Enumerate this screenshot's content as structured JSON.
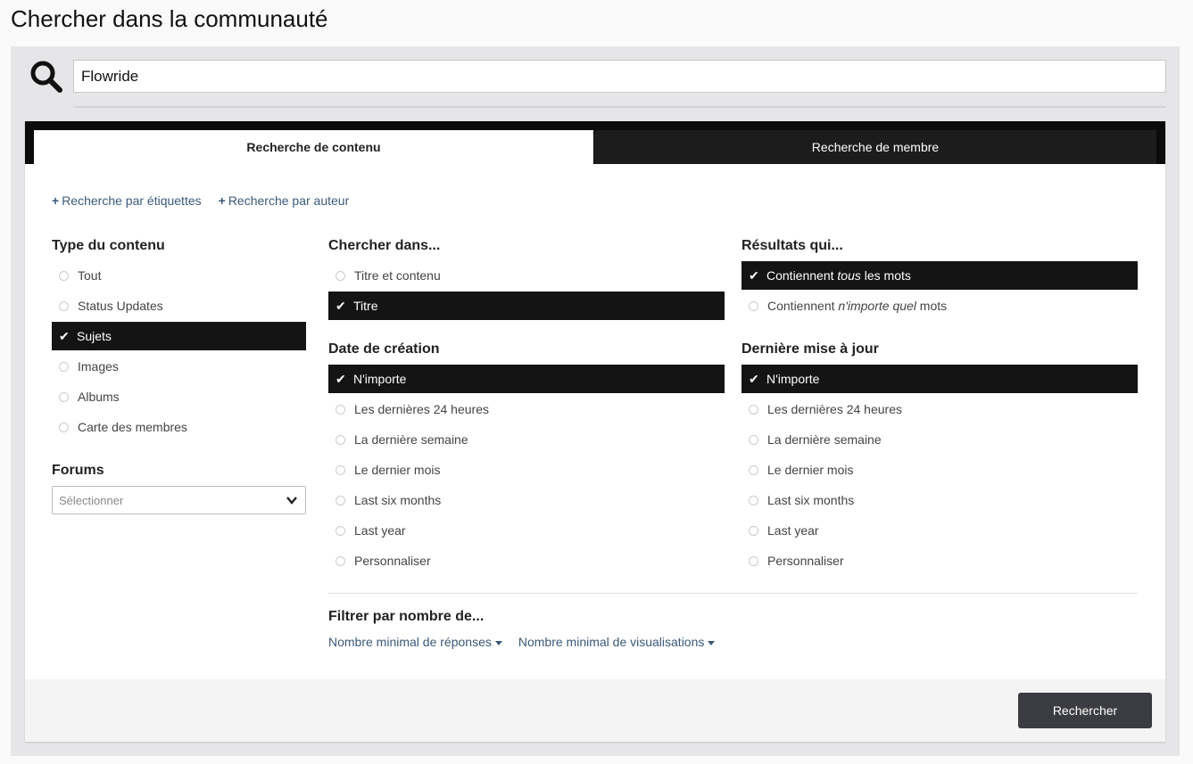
{
  "page": {
    "title": "Chercher dans la communauté"
  },
  "search": {
    "value": "Flowride"
  },
  "tabs": [
    {
      "label": "Recherche de contenu",
      "active": true
    },
    {
      "label": "Recherche de membre",
      "active": false
    }
  ],
  "add_links": [
    {
      "icon": "+",
      "label": "Recherche par étiquettes"
    },
    {
      "icon": "+",
      "label": "Recherche par auteur"
    }
  ],
  "content_type": {
    "heading": "Type du contenu",
    "options": [
      {
        "label": "Tout",
        "selected": false
      },
      {
        "label": "Status Updates",
        "selected": false
      },
      {
        "label": "Sujets",
        "selected": true
      },
      {
        "label": "Images",
        "selected": false
      },
      {
        "label": "Albums",
        "selected": false
      },
      {
        "label": "Carte des membres",
        "selected": false
      }
    ]
  },
  "forums": {
    "heading": "Forums",
    "placeholder": "Sélectionner"
  },
  "search_in": {
    "heading": "Chercher dans...",
    "options": [
      {
        "label": "Titre et contenu",
        "selected": false
      },
      {
        "label": "Titre",
        "selected": true
      }
    ]
  },
  "results": {
    "heading": "Résultats qui...",
    "options": [
      {
        "pre": "Contiennent ",
        "em": "tous",
        "post": " les mots",
        "selected": true
      },
      {
        "pre": "Contiennent ",
        "em": "n'importe quel",
        "post": " mots",
        "selected": false
      }
    ]
  },
  "created": {
    "heading": "Date de création",
    "options": [
      {
        "label": "N'importe",
        "selected": true
      },
      {
        "label": "Les dernières 24 heures",
        "selected": false
      },
      {
        "label": "La dernière semaine",
        "selected": false
      },
      {
        "label": "Le dernier mois",
        "selected": false
      },
      {
        "label": "Last six months",
        "selected": false
      },
      {
        "label": "Last year",
        "selected": false
      },
      {
        "label": "Personnaliser",
        "selected": false
      }
    ]
  },
  "updated": {
    "heading": "Dernière mise à jour",
    "options": [
      {
        "label": "N'importe",
        "selected": true
      },
      {
        "label": "Les dernières 24 heures",
        "selected": false
      },
      {
        "label": "La dernière semaine",
        "selected": false
      },
      {
        "label": "Le dernier mois",
        "selected": false
      },
      {
        "label": "Last six months",
        "selected": false
      },
      {
        "label": "Last year",
        "selected": false
      },
      {
        "label": "Personnaliser",
        "selected": false
      }
    ]
  },
  "filter": {
    "heading": "Filtrer par nombre de...",
    "links": [
      "Nombre minimal de réponses",
      "Nombre minimal de visualisations"
    ]
  },
  "submit": {
    "label": "Rechercher"
  },
  "colors": {
    "accent_dark": "#141414",
    "link": "#3b5a7a",
    "button": "#3b3c41"
  }
}
